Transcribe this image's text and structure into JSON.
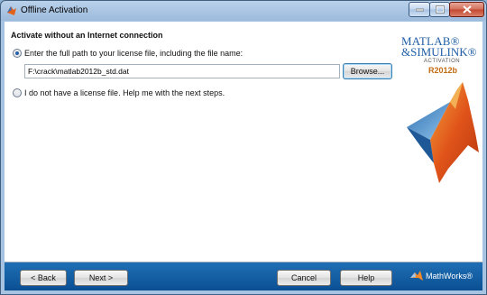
{
  "window": {
    "title": "Offline Activation"
  },
  "heading": "Activate without an Internet connection",
  "option_file": {
    "label": "Enter the full path to your license file, including the file name:",
    "selected": true
  },
  "path_input": {
    "value": "F:\\crack\\matlab2012b_std.dat"
  },
  "browse_label": "Browse...",
  "option_help": {
    "label": "I do not have a license file.  Help me with the next steps.",
    "selected": false
  },
  "logo": {
    "line1": "MATLAB®",
    "line2": "&SIMULINK®",
    "line3": "ACTIVATION",
    "release": "R2012b"
  },
  "buttons": {
    "back": "< Back",
    "next": "Next >",
    "cancel": "Cancel",
    "help": "Help"
  },
  "brand": "MathWorks®",
  "colors": {
    "footer": "#0b4f93",
    "logo_blue": "#205fa6",
    "release_orange": "#c46b12"
  }
}
